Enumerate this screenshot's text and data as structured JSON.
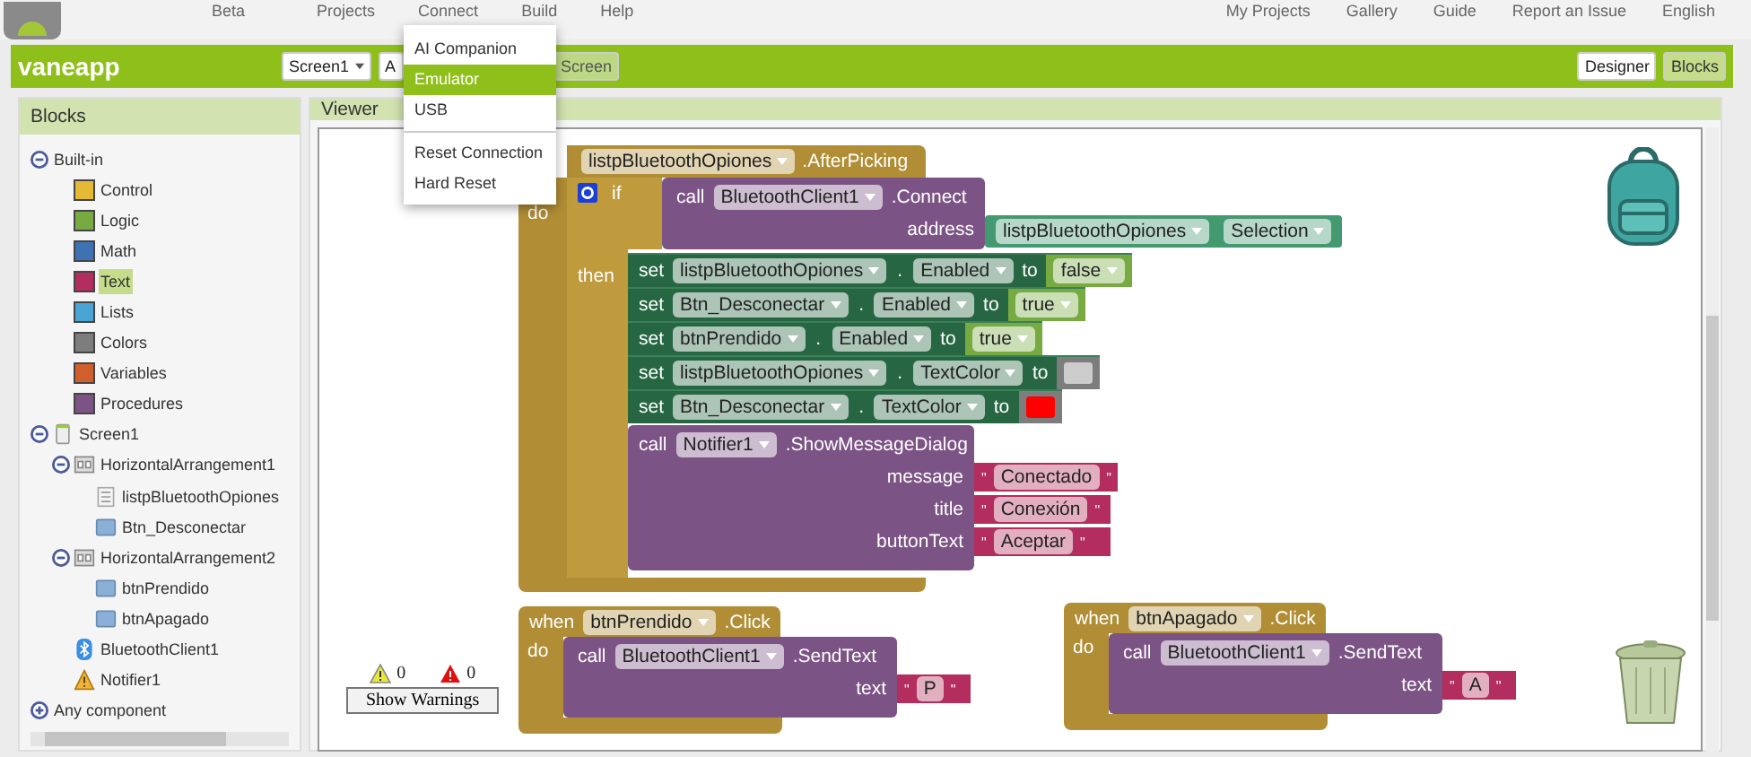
{
  "top_nav": {
    "beta": "Beta",
    "menus": [
      "Projects",
      "Connect",
      "Build",
      "Help"
    ],
    "right_links": [
      "My Projects",
      "Gallery",
      "Guide",
      "Report an Issue",
      "English"
    ]
  },
  "project_bar": {
    "title": "vaneapp",
    "screen_button": "Screen1",
    "add_screen_partial": "A",
    "remove_screen_partial": "Screen",
    "modes": [
      {
        "label": "Designer",
        "selected": false
      },
      {
        "label": "Blocks",
        "selected": true
      }
    ]
  },
  "connect_menu": {
    "items": [
      {
        "kind": "item",
        "label": "AI Companion",
        "selected": false
      },
      {
        "kind": "item",
        "label": "Emulator",
        "selected": true
      },
      {
        "kind": "item",
        "label": "USB",
        "selected": false
      },
      {
        "kind": "divider"
      },
      {
        "kind": "item",
        "label": "Reset Connection",
        "selected": false
      },
      {
        "kind": "item",
        "label": "Hard Reset",
        "selected": false
      }
    ]
  },
  "blocks_panel": {
    "title": "Blocks",
    "tree": [
      {
        "label": "Built-in",
        "expanded": true,
        "children": [
          {
            "label": "Control",
            "color": "#e3b935",
            "selected": false
          },
          {
            "label": "Logic",
            "color": "#77ab41",
            "selected": false
          },
          {
            "label": "Math",
            "color": "#3f71b5",
            "selected": false
          },
          {
            "label": "Text",
            "color": "#b32d5e",
            "selected": true
          },
          {
            "label": "Lists",
            "color": "#49a6d4",
            "selected": false
          },
          {
            "label": "Colors",
            "color": "#7d7d7d",
            "selected": false
          },
          {
            "label": "Variables",
            "color": "#d05f2d",
            "selected": false
          },
          {
            "label": "Procedures",
            "color": "#7c5385",
            "selected": false
          }
        ]
      },
      {
        "label": "Screen1",
        "kind": "screen",
        "expanded": true,
        "children": [
          {
            "label": "HorizontalArrangement1",
            "kind": "arrangement",
            "expanded": true,
            "children": [
              {
                "label": "listpBluetoothOpiones",
                "kind": "listpicker"
              },
              {
                "label": "Btn_Desconectar",
                "kind": "button"
              }
            ]
          },
          {
            "label": "HorizontalArrangement2",
            "kind": "arrangement",
            "expanded": true,
            "children": [
              {
                "label": "btnPrendido",
                "kind": "button"
              },
              {
                "label": "btnApagado",
                "kind": "button"
              }
            ]
          },
          {
            "label": "BluetoothClient1",
            "kind": "bluetooth"
          },
          {
            "label": "Notifier1",
            "kind": "notifier"
          }
        ]
      },
      {
        "label": "Any component",
        "expanded": false
      }
    ]
  },
  "viewer": {
    "title": "Viewer",
    "workspace": {
      "quote": "\"",
      "picking_event": {
        "component": "listpBluetoothOpiones",
        "event": ".AfterPicking",
        "do_label": "do",
        "if_block": {
          "if_label": "if",
          "then_label": "then",
          "condition": {
            "call_label": "call",
            "component": "BluetoothClient1",
            "method": ".Connect",
            "arg_label": "address",
            "arg_component": "listpBluetoothOpiones",
            "arg_property": "Selection"
          },
          "setters": [
            {
              "set_label": "set",
              "component": "listpBluetoothOpiones",
              "separator": ".",
              "property": "Enabled",
              "to_label": "to",
              "kind": "logic",
              "value": "false"
            },
            {
              "set_label": "set",
              "component": "Btn_Desconectar",
              "separator": ".",
              "property": "Enabled",
              "to_label": "to",
              "kind": "logic",
              "value": "true"
            },
            {
              "set_label": "set",
              "component": "btnPrendido",
              "separator": ".",
              "property": "Enabled",
              "to_label": "to",
              "kind": "logic",
              "value": "true"
            },
            {
              "set_label": "set",
              "component": "listpBluetoothOpiones",
              "separator": ".",
              "property": "TextColor",
              "to_label": "to",
              "kind": "color",
              "color": "#cccccc"
            },
            {
              "set_label": "set",
              "component": "Btn_Desconectar",
              "separator": ".",
              "property": "TextColor",
              "to_label": "to",
              "kind": "color",
              "color": "#ff0000"
            }
          ],
          "dialog": {
            "call_label": "call",
            "component": "Notifier1",
            "method": ".ShowMessageDialog",
            "args": [
              {
                "label": "message",
                "value": "Conectado"
              },
              {
                "label": "title",
                "value": "Conexión"
              },
              {
                "label": "buttonText",
                "value": "Aceptar"
              }
            ]
          }
        }
      },
      "click_events": [
        {
          "when_label": "when",
          "component": "btnPrendido",
          "event": ".Click",
          "do_label": "do",
          "call_label": "call",
          "target": "BluetoothClient1",
          "method": ".SendText",
          "arg_label": "text",
          "value": "P"
        },
        {
          "when_label": "when",
          "component": "btnApagado",
          "event": ".Click",
          "do_label": "do",
          "call_label": "call",
          "target": "BluetoothClient1",
          "method": ".SendText",
          "arg_label": "text",
          "value": "A"
        }
      ],
      "warnings": {
        "warning_count": "0",
        "error_count": "0",
        "button": "Show Warnings"
      }
    }
  }
}
